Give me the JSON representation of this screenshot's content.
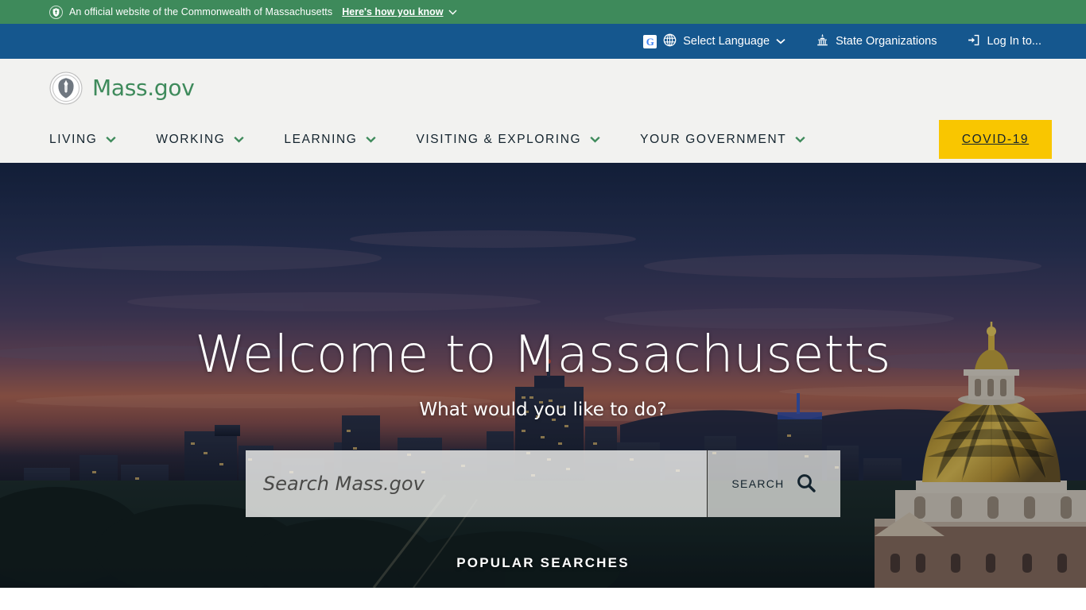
{
  "gov_banner": {
    "shield_icon": "shield-icon",
    "text": "An official website of the Commonwealth of Massachusetts",
    "how_you_know_label": "Here's how you know",
    "chevron_icon": "chevron-down-icon",
    "background_color": "#3e8a5b"
  },
  "utility_bar": {
    "background_color": "#15578e",
    "items": [
      {
        "label": "Select Language",
        "icon": "globe-icon",
        "secondary_icon": "google-g-icon",
        "chevron": "chevron-down-icon"
      },
      {
        "label": "State Organizations",
        "icon": "capitol-building-icon"
      },
      {
        "label": "Log In to...",
        "icon": "login-arrow-icon"
      }
    ]
  },
  "header": {
    "seal_icon": "massachusetts-state-seal-icon",
    "brand": "Mass.gov",
    "brand_color": "#3e8a5b",
    "background_color": "#f2f2f0"
  },
  "nav": {
    "items": [
      {
        "label": "LIVING",
        "chevron": "chevron-down-icon"
      },
      {
        "label": "WORKING",
        "chevron": "chevron-down-icon"
      },
      {
        "label": "LEARNING",
        "chevron": "chevron-down-icon"
      },
      {
        "label": "VISITING & EXPLORING",
        "chevron": "chevron-down-icon"
      },
      {
        "label": "YOUR GOVERNMENT",
        "chevron": "chevron-down-icon"
      }
    ],
    "covid_label": "COVID-19",
    "covid_background_color": "#f9c600"
  },
  "hero": {
    "title": "Welcome to Massachusetts",
    "subtitle": "What would you like to do?",
    "search_placeholder": "Search Mass.gov",
    "search_value": "",
    "search_button_label": "SEARCH",
    "search_icon": "magnifier-icon",
    "popular_searches_label": "POPULAR SEARCHES",
    "image_description": "Boston skyline at dusk with the Massachusetts State House golden dome"
  }
}
